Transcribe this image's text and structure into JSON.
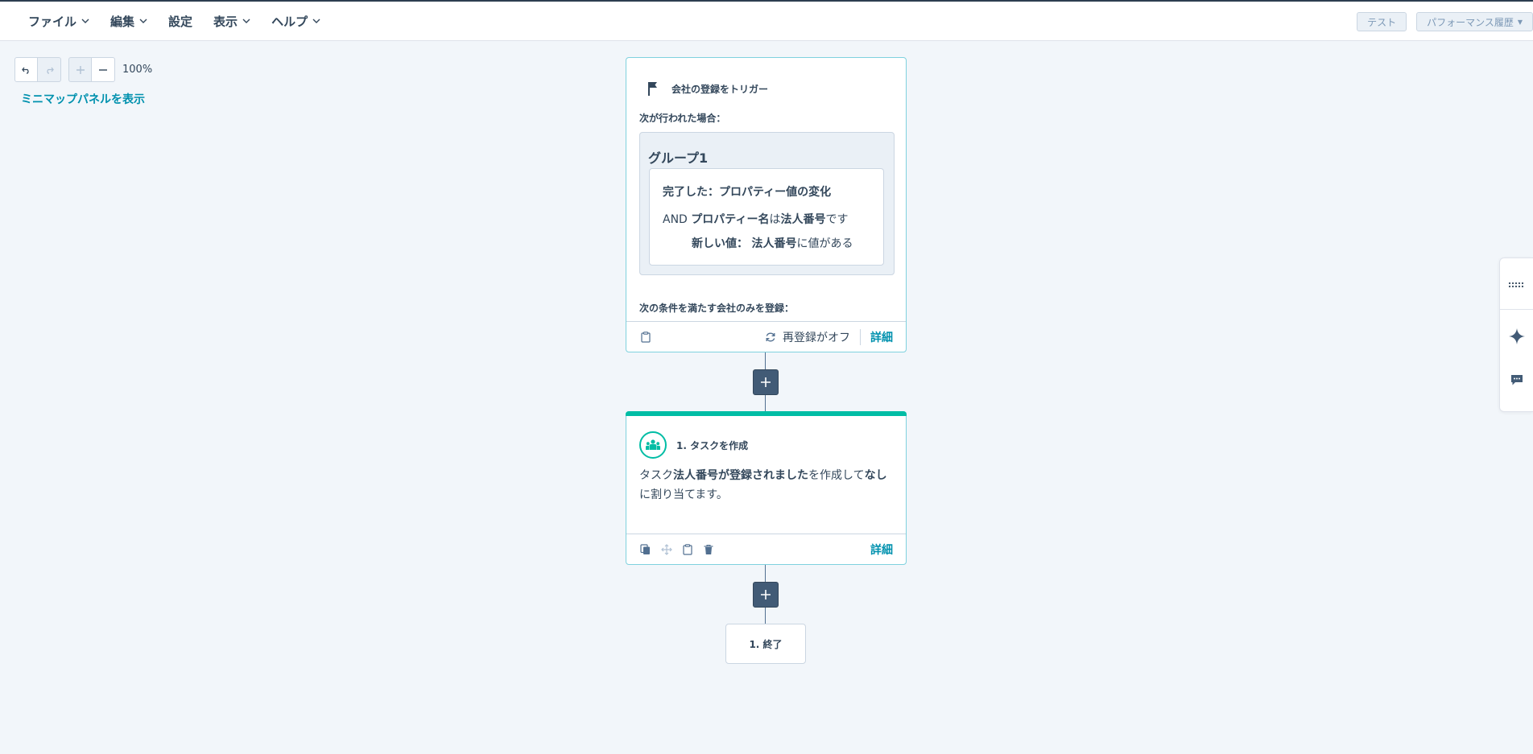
{
  "menu": {
    "file": "ファイル",
    "edit": "編集",
    "settings": "設定",
    "view": "表示",
    "help": "ヘルプ"
  },
  "toolbar": {
    "test_label": "テスト",
    "performance_label": "パフォーマンス履歴"
  },
  "canvas": {
    "zoom_level": "100%",
    "minimap_link": "ミニマップパネルを表示"
  },
  "trigger": {
    "title": "会社の登録をトリガー",
    "when_label": "次が行われた場合：",
    "group_title": "グループ1",
    "condition": {
      "completed_prefix": "完了した：",
      "completed_value": "プロパティー値の変化",
      "and_label": "AND",
      "property_name": "プロパティー名",
      "is_label": "は",
      "property_value": "法人番号",
      "desu": "です",
      "new_value_label": "新しい値：",
      "new_value_property": "法人番号",
      "new_value_suffix": "に値がある"
    },
    "enroll_label": "次の条件を満たす会社のみを登録：",
    "reenroll_label": "再登録がオフ",
    "detail_label": "詳細"
  },
  "action": {
    "title": "1. タスクを作成",
    "body_prefix": "タスク",
    "task_name": "法人番号が登録されました",
    "body_middle": "を作成して",
    "assignee": "なし",
    "body_suffix": "に割り当てます。",
    "detail_label": "詳細",
    "accent_color": "#00bda5"
  },
  "end_node": {
    "label": "1. 終了"
  },
  "colors": {
    "link": "#0091ae",
    "plus_button": "#425b76",
    "card_border": "#7fd1de"
  }
}
